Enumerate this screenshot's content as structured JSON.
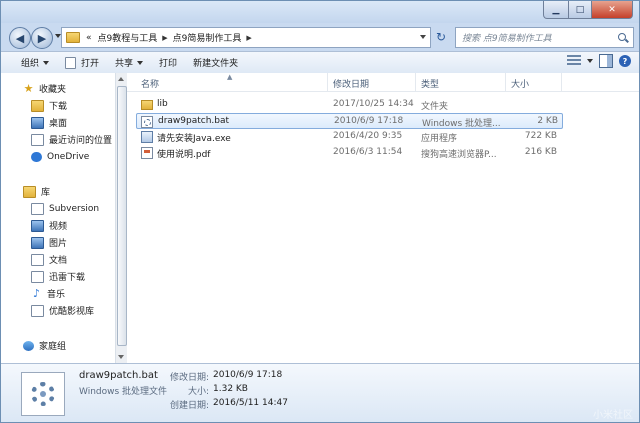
{
  "address": {
    "crumbs": [
      "«",
      "点9教程与工具",
      "点9简易制作工具"
    ],
    "search_placeholder": "搜索 点9简易制作工具"
  },
  "toolbar": {
    "organize": "组织",
    "open": "打开",
    "share": "共享",
    "print": "打印",
    "new_folder": "新建文件夹"
  },
  "nav": {
    "favorites": "收藏夹",
    "fav_items": [
      "下载",
      "桌面",
      "最近访问的位置",
      "OneDrive"
    ],
    "library": "库",
    "lib_items": [
      "Subversion",
      "视频",
      "图片",
      "文档",
      "迅雷下载",
      "音乐",
      "优酷影视库"
    ],
    "homegroup": "家庭组"
  },
  "columns": {
    "name": "名称",
    "modified": "修改日期",
    "type": "类型",
    "size": "大小"
  },
  "files": [
    {
      "name": "lib",
      "modified": "2017/10/25 14:34",
      "type": "文件夹",
      "size": "",
      "icon": "folder-icon",
      "selected": false
    },
    {
      "name": "draw9patch.bat",
      "modified": "2010/6/9 17:18",
      "type": "Windows 批处理...",
      "size": "2 KB",
      "icon": "batch-file-icon",
      "selected": true
    },
    {
      "name": "请先安装Java.exe",
      "modified": "2016/4/20 9:35",
      "type": "应用程序",
      "size": "722 KB",
      "icon": "exe-file-icon",
      "selected": false
    },
    {
      "name": "使用说明.pdf",
      "modified": "2016/6/3 11:54",
      "type": "搜狗高速浏览器P...",
      "size": "216 KB",
      "icon": "pdf-file-icon",
      "selected": false
    }
  ],
  "details": {
    "filename": "draw9patch.bat",
    "filetype": "Windows 批处理文件",
    "modified_label": "修改日期:",
    "modified_value": "2010/6/9 17:18",
    "size_label": "大小:",
    "size_value": "1.32 KB",
    "created_label": "创建日期:",
    "created_value": "2016/5/11 14:47"
  },
  "watermark": "小米社区"
}
